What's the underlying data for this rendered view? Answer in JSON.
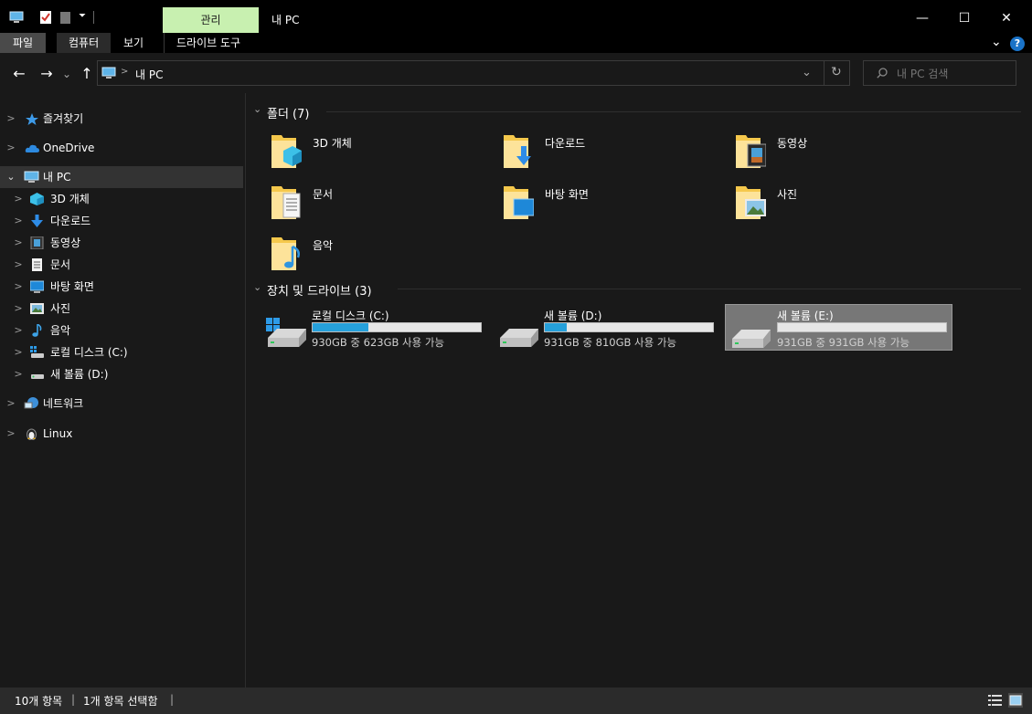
{
  "window": {
    "title": "내 PC",
    "context_tab": "관리",
    "min_glyph": "—",
    "max_glyph": "☐",
    "close_glyph": "✕"
  },
  "ribbon": {
    "tabs": [
      "파일",
      "컴퓨터",
      "보기",
      "드라이브 도구"
    ],
    "help_glyph": "?",
    "collapse_glyph": "⌄"
  },
  "nav": {
    "back_glyph": "←",
    "forward_glyph": "→",
    "recent_glyph": "⌄",
    "up_glyph": "↑",
    "address_sep": ">",
    "address": "내 PC",
    "dropdown_glyph": "⌄",
    "refresh_glyph": "↻",
    "search_placeholder": "내 PC 검색"
  },
  "sidebar": {
    "items": [
      {
        "label": "즐겨찾기",
        "icon": "star-icon"
      },
      {
        "label": "OneDrive",
        "icon": "cloud-icon"
      },
      {
        "label": "내 PC",
        "icon": "pc-icon"
      },
      {
        "label": "3D 개체",
        "icon": "cube-icon"
      },
      {
        "label": "다운로드",
        "icon": "download-icon"
      },
      {
        "label": "동영상",
        "icon": "video-icon"
      },
      {
        "label": "문서",
        "icon": "document-icon"
      },
      {
        "label": "바탕 화면",
        "icon": "desktop-icon"
      },
      {
        "label": "사진",
        "icon": "picture-icon"
      },
      {
        "label": "음악",
        "icon": "music-icon"
      },
      {
        "label": "로컬 디스크 (C:)",
        "icon": "drive-icon"
      },
      {
        "label": "새 볼륨 (D:)",
        "icon": "drive-icon"
      },
      {
        "label": "네트워크",
        "icon": "network-icon"
      },
      {
        "label": "Linux",
        "icon": "linux-icon"
      }
    ]
  },
  "main": {
    "folders_header": "폴더 (7)",
    "folders": [
      {
        "label": "3D 개체",
        "icon": "cube-icon"
      },
      {
        "label": "다운로드",
        "icon": "download-icon"
      },
      {
        "label": "동영상",
        "icon": "video-icon"
      },
      {
        "label": "문서",
        "icon": "document-icon"
      },
      {
        "label": "바탕 화면",
        "icon": "desktop-icon"
      },
      {
        "label": "사진",
        "icon": "picture-icon"
      },
      {
        "label": "음악",
        "icon": "music-icon"
      }
    ],
    "drives_header": "장치 및 드라이브 (3)",
    "drives": [
      {
        "name": "로컬 디스크 (C:)",
        "free": "930GB 중 623GB 사용 가능",
        "used_fraction": 0.33,
        "selected": false,
        "windows_logo": true
      },
      {
        "name": "새 볼륨 (D:)",
        "free": "931GB 중 810GB 사용 가능",
        "used_fraction": 0.13,
        "selected": false,
        "windows_logo": false
      },
      {
        "name": "새 볼륨 (E:)",
        "free": "931GB 중 931GB 사용 가능",
        "used_fraction": 0.0,
        "selected": true,
        "windows_logo": false
      }
    ]
  },
  "status": {
    "item_count": "10개 항목",
    "selected": "1개 항목 선택함",
    "sep": "|"
  },
  "colors": {
    "accent": "#26a0da",
    "context_tab": "#c8f0b0",
    "background": "#191919"
  }
}
